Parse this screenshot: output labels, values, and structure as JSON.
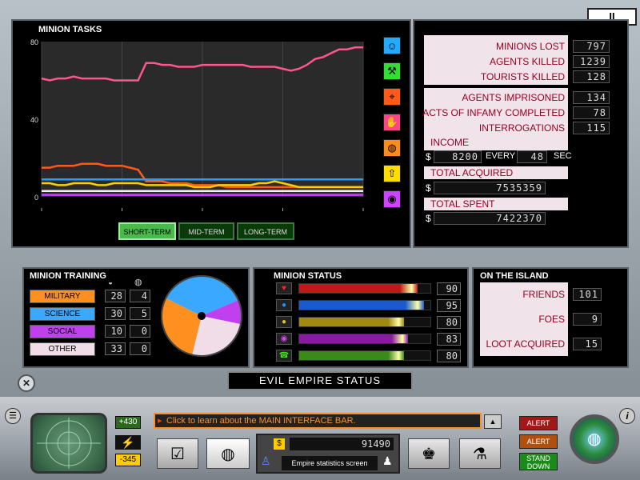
{
  "pause_label": "II",
  "tasks": {
    "title": "MINION TASKS",
    "buttons": [
      "SHORT-TERM",
      "MID-TERM",
      "LONG-TERM"
    ]
  },
  "chart_data": {
    "type": "line",
    "title": "MINION TASKS",
    "ylim": [
      0,
      80
    ],
    "yticks": [
      "80",
      "40",
      "0"
    ],
    "x": [
      0,
      1,
      2,
      3,
      4,
      5,
      6,
      7,
      8,
      9,
      10,
      11,
      12,
      13,
      14,
      15,
      16,
      17,
      18,
      19,
      20,
      21,
      22,
      23,
      24,
      25,
      26,
      27,
      28,
      29,
      30,
      31,
      32,
      33,
      34,
      35,
      36,
      37,
      38,
      39,
      40
    ],
    "series": [
      {
        "color": "#ff5590",
        "values": [
          61,
          60,
          61,
          61,
          62,
          61,
          61,
          61,
          61,
          60,
          60,
          60,
          60,
          69,
          69,
          68,
          68,
          67,
          67,
          67,
          68,
          68,
          68,
          68,
          68,
          68,
          67,
          67,
          67,
          67,
          66,
          65,
          66,
          68,
          71,
          72,
          74,
          76,
          76,
          77,
          77
        ]
      },
      {
        "color": "#ff5a1a",
        "values": [
          15,
          15,
          16,
          16,
          16,
          17,
          17,
          17,
          16,
          16,
          16,
          15,
          14,
          8,
          8,
          8,
          7,
          7,
          7,
          6,
          6,
          6,
          6,
          5,
          5,
          5,
          5,
          5,
          5,
          5,
          5,
          5,
          5,
          5,
          5,
          5,
          5,
          5,
          5,
          5,
          5
        ]
      },
      {
        "color": "#2a9cff",
        "values": [
          9,
          9,
          9,
          9,
          9,
          9,
          9,
          9,
          9,
          9,
          9,
          9,
          9,
          9,
          9,
          9,
          9,
          9,
          9,
          9,
          9,
          9,
          9,
          9,
          9,
          9,
          9,
          9,
          9,
          9,
          9,
          9,
          9,
          9,
          9,
          9,
          9,
          9,
          9,
          9,
          9
        ]
      },
      {
        "color": "#ffcc00",
        "values": [
          7,
          7,
          6,
          6,
          7,
          7,
          7,
          6,
          6,
          7,
          7,
          7,
          7,
          6,
          6,
          6,
          6,
          6,
          6,
          5,
          5,
          5,
          6,
          6,
          6,
          6,
          6,
          7,
          7,
          8,
          7,
          6,
          5,
          5,
          5,
          5,
          5,
          5,
          5,
          5,
          5
        ]
      },
      {
        "color": "#cc44ff",
        "values": [
          1,
          1,
          1,
          1,
          1,
          1,
          1,
          1,
          1,
          1,
          1,
          1,
          1,
          1,
          1,
          1,
          1,
          1,
          1,
          1,
          1,
          1,
          1,
          1,
          1,
          1,
          1,
          1,
          1,
          1,
          1,
          1,
          1,
          1,
          1,
          1,
          1,
          1,
          1,
          1,
          1
        ]
      },
      {
        "color": "#f0f0f0",
        "values": [
          3,
          3,
          3,
          3,
          3,
          3,
          3,
          3,
          3,
          3,
          3,
          3,
          3,
          3,
          3,
          3,
          3,
          3,
          3,
          3,
          3,
          3,
          3,
          3,
          3,
          3,
          3,
          3,
          3,
          3,
          3,
          3,
          3,
          3,
          3,
          3,
          3,
          3,
          3,
          3,
          3
        ]
      }
    ]
  },
  "legend_icons": [
    {
      "name": "social-icon",
      "color": "#22aaff",
      "glyph": "☺"
    },
    {
      "name": "hammer-icon",
      "color": "#33dd33",
      "glyph": "⚒"
    },
    {
      "name": "crosshair-icon",
      "color": "#ff5a1a",
      "glyph": "⌖"
    },
    {
      "name": "hand-icon",
      "color": "#ff4488",
      "glyph": "✋"
    },
    {
      "name": "globe-icon",
      "color": "#ff8c1a",
      "glyph": "◍"
    },
    {
      "name": "arrow-up-icon",
      "color": "#ffdd00",
      "glyph": "⇧"
    },
    {
      "name": "eye-icon",
      "color": "#cc44ff",
      "glyph": "◉"
    }
  ],
  "stats": {
    "minions_lost": {
      "label": "MINIONS LOST",
      "value": "797"
    },
    "agents_killed": {
      "label": "AGENTS KILLED",
      "value": "1239"
    },
    "tourists_killed": {
      "label": "TOURISTS KILLED",
      "value": "128"
    },
    "agents_imprisoned": {
      "label": "AGENTS IMPRISONED",
      "value": "134"
    },
    "acts_infamy": {
      "label": "ACTS OF INFAMY COMPLETED",
      "value": "78"
    },
    "interrogations": {
      "label": "INTERROGATIONS",
      "value": "115"
    },
    "income_label": "INCOME",
    "income_value": "8200",
    "every_label": "EVERY",
    "every_value": "48",
    "sec_label": "SEC",
    "total_acquired_label": "TOTAL ACQUIRED",
    "total_acquired_value": "7535359",
    "total_spent_label": "TOTAL SPENT",
    "total_spent_value": "7422370",
    "currency": "$"
  },
  "training": {
    "title": "MINION TRAINING",
    "rows": [
      {
        "label": "MILITARY",
        "a": "28",
        "b": "4",
        "color": "#ff9020"
      },
      {
        "label": "SCIENCE",
        "a": "30",
        "b": "5",
        "color": "#3aa8ff"
      },
      {
        "label": "SOCIAL",
        "a": "10",
        "b": "0",
        "color": "#c040f0"
      },
      {
        "label": "OTHER",
        "a": "33",
        "b": "0",
        "color": "#f0dde8"
      }
    ]
  },
  "status": {
    "title": "MINION STATUS",
    "rows": [
      {
        "icon": "heart-icon",
        "glyph": "♥",
        "value": "90",
        "level": 0.9,
        "color": "#c01818",
        "iconcolor": "#ff2222"
      },
      {
        "icon": "brain-icon",
        "glyph": "●",
        "value": "95",
        "level": 0.95,
        "color": "#1a5acc",
        "iconcolor": "#2a8cff"
      },
      {
        "icon": "coin-icon",
        "glyph": "●",
        "value": "80",
        "level": 0.8,
        "color": "#a08a10",
        "iconcolor": "#e0c020"
      },
      {
        "icon": "swirl-icon",
        "glyph": "◉",
        "value": "83",
        "level": 0.83,
        "color": "#8a1aa0",
        "iconcolor": "#dd44ff"
      },
      {
        "icon": "phone-icon",
        "glyph": "☎",
        "value": "80",
        "level": 0.8,
        "color": "#3a8a1a",
        "iconcolor": "#44dd22"
      }
    ]
  },
  "island": {
    "title": "ON THE ISLAND",
    "friends_label": "FRIENDS",
    "friends_value": "101",
    "foes_label": "FOES",
    "foes_value": "9",
    "loot_label": "LOOT ACQUIRED",
    "loot_value": "15"
  },
  "screen_title": "EVIL EMPIRE STATUS",
  "bottom": {
    "plus_value": "+430",
    "minus_value": "-345",
    "message": "Click to learn about the MAIN INTERFACE BAR.",
    "money": "91490",
    "tooltip": "Empire statistics screen",
    "alert1": "ALERT",
    "alert2": "ALERT",
    "stand_down": "STAND DOWN",
    "info": "i",
    "close": "✕"
  }
}
